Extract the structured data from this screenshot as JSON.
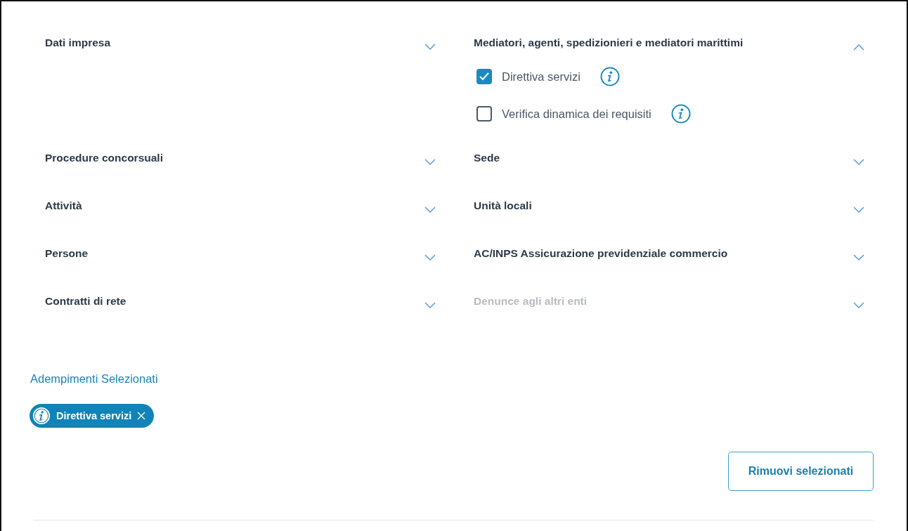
{
  "columns": [
    {
      "sections": [
        {
          "title": "Dati impresa",
          "expanded": false,
          "disabled": false
        },
        {
          "title": "Procedure concorsuali",
          "expanded": false,
          "disabled": false
        },
        {
          "title": "Attività",
          "expanded": false,
          "disabled": false
        },
        {
          "title": "Persone",
          "expanded": false,
          "disabled": false
        },
        {
          "title": "Contratti di rete",
          "expanded": false,
          "disabled": false
        }
      ]
    },
    {
      "sections": [
        {
          "title": "Mediatori, agenti, spedizionieri e mediatori marittimi",
          "expanded": true,
          "disabled": false,
          "options": [
            {
              "label": "Direttiva servizi",
              "checked": true
            },
            {
              "label": "Verifica dinamica dei requisiti",
              "checked": false
            }
          ]
        },
        {
          "title": "Sede",
          "expanded": false,
          "disabled": false
        },
        {
          "title": "Unità locali",
          "expanded": false,
          "disabled": false
        },
        {
          "title": "AC/INPS Assicurazione previdenziale commercio",
          "expanded": false,
          "disabled": false
        },
        {
          "title": "Denunce agli altri enti",
          "expanded": false,
          "disabled": true
        }
      ]
    }
  ],
  "selected": {
    "title": "Adempimenti Selezionati",
    "chips": [
      {
        "label": "Direttiva servizi"
      }
    ]
  },
  "remove_button": "Rimuovi selezionati"
}
